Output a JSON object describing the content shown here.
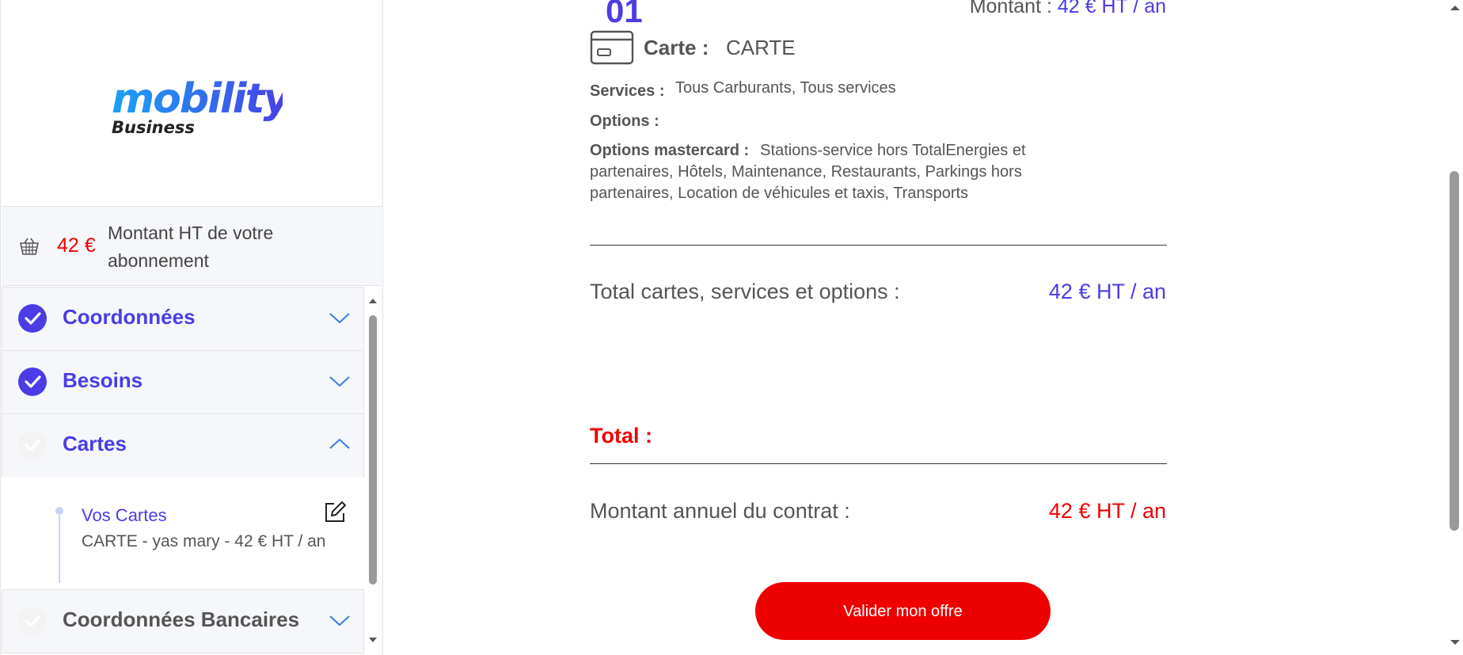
{
  "sidebar": {
    "logo": {
      "word": "mobility",
      "sub": "Business"
    },
    "amount": {
      "value": "42 €",
      "label": "Montant HT de votre abonnement"
    },
    "sections": [
      {
        "title": "Coordonnées",
        "status": "done",
        "expanded": false
      },
      {
        "title": "Besoins",
        "status": "done",
        "expanded": false
      },
      {
        "title": "Cartes",
        "status": "todo",
        "expanded": true
      },
      {
        "title": "Coordonnées Bancaires",
        "status": "todo",
        "expanded": false
      }
    ],
    "cards_sub": {
      "title": "Vos Cartes",
      "desc": "CARTE - yas mary - 42 € HT / an"
    }
  },
  "main": {
    "card_number": "01",
    "montant_label": "Montant :",
    "montant_value": "42 € HT / an",
    "carte_label": "Carte :",
    "carte_value": "CARTE",
    "services_label": "Services :",
    "services_value": "Tous Carburants, Tous services",
    "options_label": "Options :",
    "options_mc_label": "Options mastercard :",
    "options_mc_value": "Stations-service hors TotalEnergies et partenaires, Hôtels, Maintenance, Restaurants, Parkings hors partenaires, Location de véhicules et taxis, Transports",
    "total_cso_label": "Total cartes, services et options :",
    "total_cso_value": "42 € HT / an",
    "total_label": "Total :",
    "annuel_label": "Montant annuel du contrat :",
    "annuel_value": "42 € HT / an",
    "validate_button": "Valider mon offre"
  },
  "colors": {
    "brand": "#4b3ce6",
    "accent_red": "#ee0000",
    "logo_blue": "#1aa2f5"
  }
}
